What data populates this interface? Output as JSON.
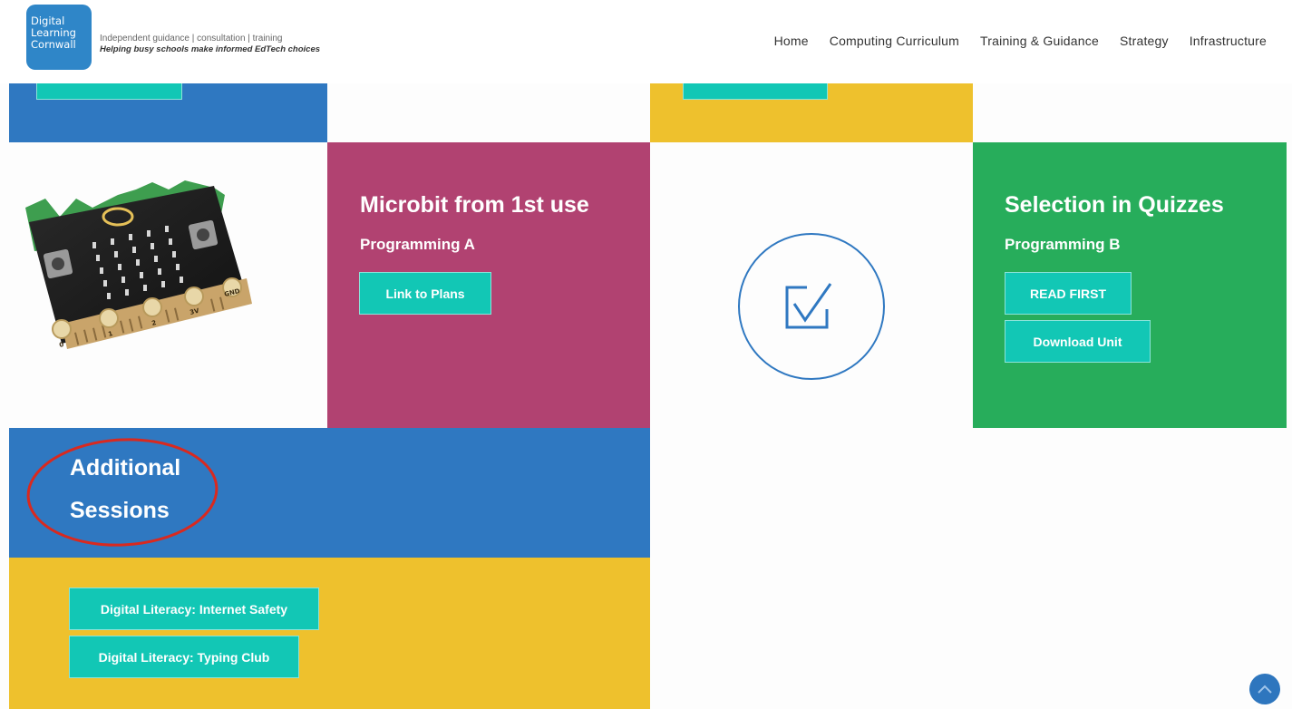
{
  "header": {
    "logo": {
      "line1": "Digital",
      "line2": "Learning",
      "line3": "Cornwall"
    },
    "tagline": "Independent guidance | consultation | training",
    "subtagline": "Helping busy schools make informed EdTech choices",
    "nav": [
      {
        "label": "Home"
      },
      {
        "label": "Computing Curriculum"
      },
      {
        "label": "Training & Guidance"
      },
      {
        "label": "Strategy"
      },
      {
        "label": "Infrastructure"
      }
    ]
  },
  "colors": {
    "blue": "#2f78c1",
    "yellow": "#eec12d",
    "magenta": "#b14271",
    "green": "#27ad5b",
    "teal": "#12c7b5",
    "annotation_red": "#d9291f"
  },
  "tiles": {
    "microbit": {
      "title": "Microbit from 1st use",
      "subtitle": "Programming A",
      "button": "Link to Plans"
    },
    "quizzes": {
      "title": "Selection in Quizzes",
      "subtitle": "Programming B",
      "buttons": [
        "READ FIRST",
        "Download Unit"
      ]
    },
    "additional": {
      "title_line1": "Additional",
      "title_line2": "Sessions"
    },
    "digital_literacy": {
      "buttons": [
        "Digital Literacy: Internet Safety",
        "Digital Literacy: Typing Club"
      ]
    }
  },
  "microbit_image": {
    "pins": [
      "0",
      "1",
      "2",
      "3V",
      "GND"
    ]
  },
  "icons": {
    "checkbox": "checkbox-check-icon",
    "scroll_top": "chevron-up-icon"
  }
}
